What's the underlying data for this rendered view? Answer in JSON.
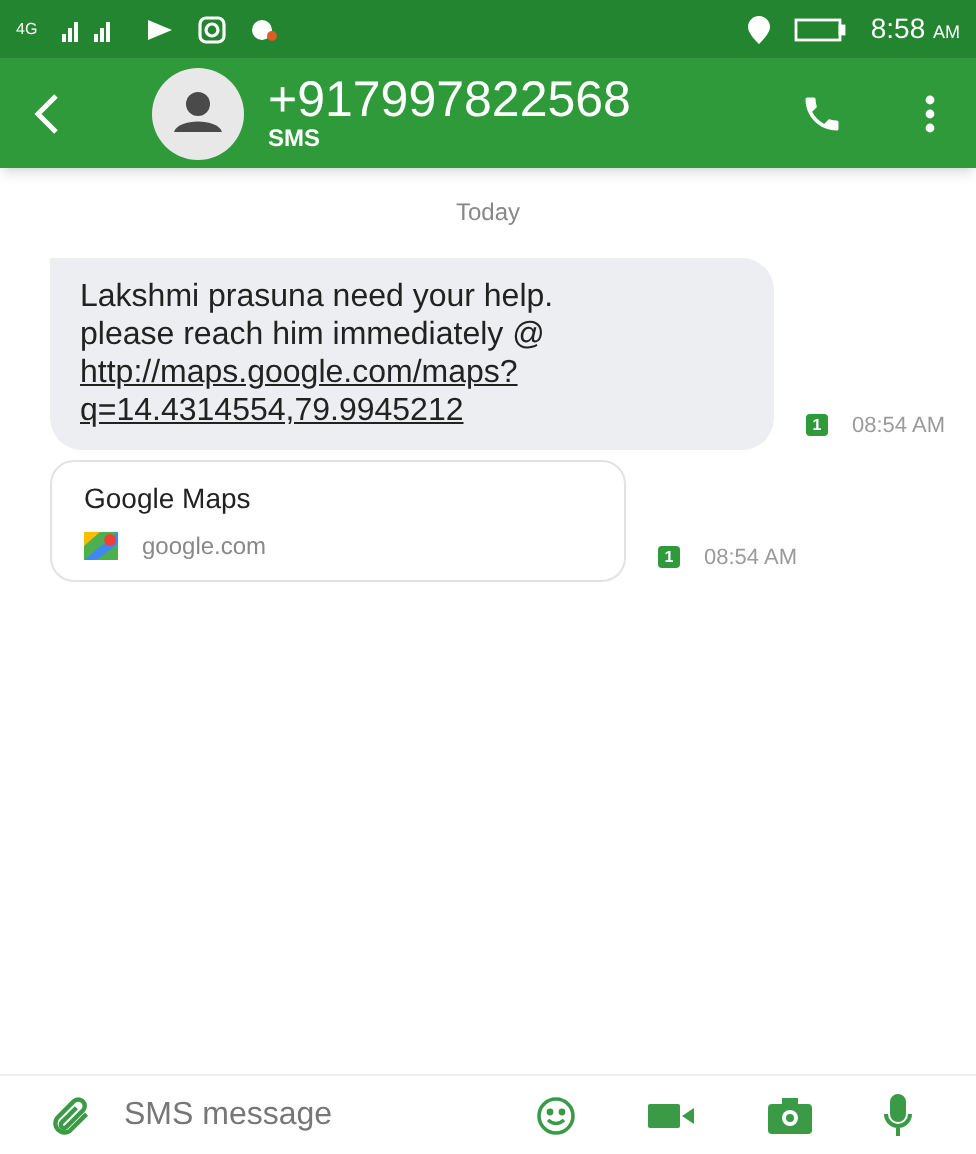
{
  "status_bar": {
    "network": "4G",
    "time": "8:58",
    "time_suffix": "AM"
  },
  "header": {
    "title": "+917997822568",
    "subtitle": "SMS"
  },
  "date_divider": "Today",
  "messages": [
    {
      "kind": "text",
      "text": "Lakshmi prasuna need your help. please reach him immediately @",
      "link_lines": [
        "http://maps.google.com/maps?",
        "q=14.4314554,79.9945212"
      ],
      "sim": "1",
      "time": "08:54 AM"
    },
    {
      "kind": "link_preview",
      "title": "Google Maps",
      "domain": "google.com",
      "sim": "1",
      "time": "08:54 AM"
    }
  ],
  "composer": {
    "placeholder": "SMS message"
  }
}
